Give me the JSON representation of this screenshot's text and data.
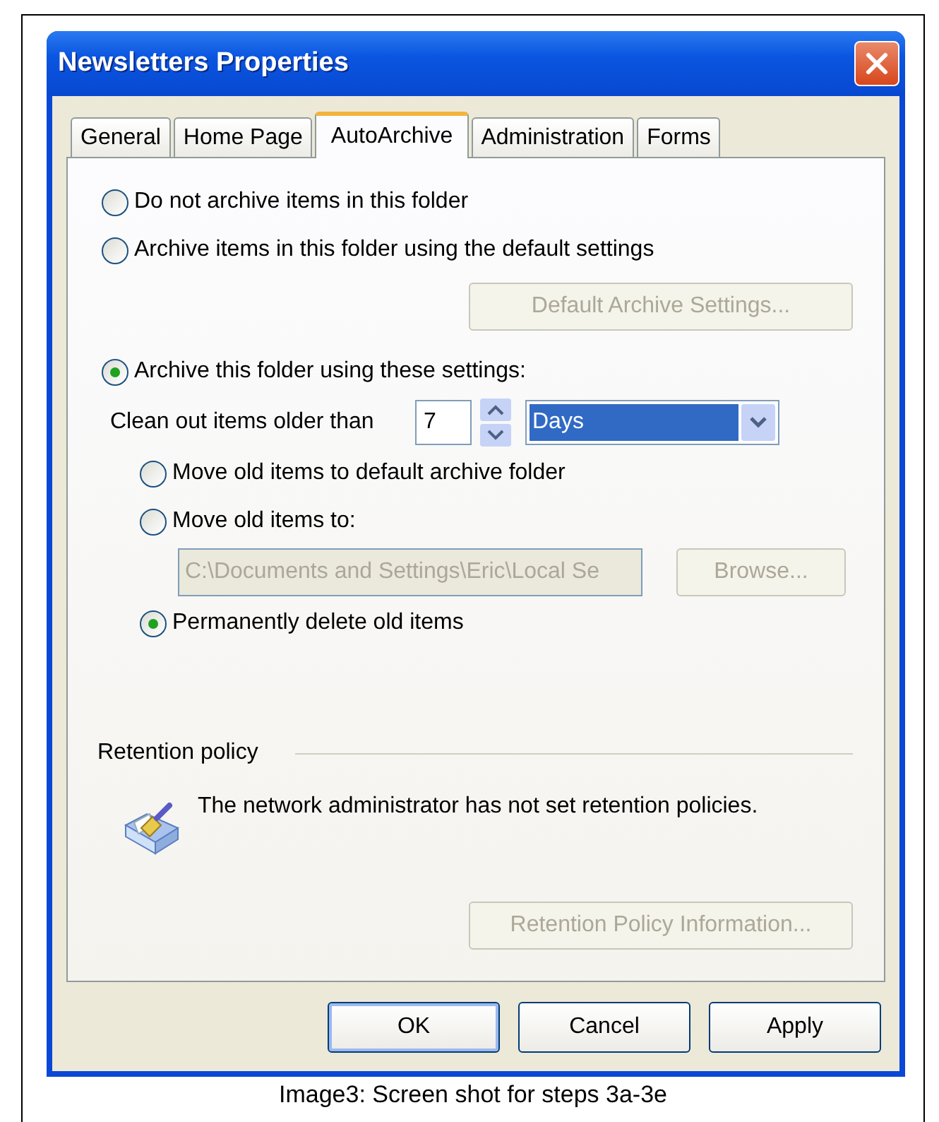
{
  "window": {
    "title": "Newsletters Properties"
  },
  "tabs": [
    {
      "label": "General",
      "selected": false
    },
    {
      "label": "Home Page",
      "selected": false
    },
    {
      "label": "AutoArchive",
      "selected": true
    },
    {
      "label": "Administration",
      "selected": false
    },
    {
      "label": "Forms",
      "selected": false
    }
  ],
  "archive_options": [
    {
      "label": "Do not archive items in this folder",
      "selected": false
    },
    {
      "label": "Archive items in this folder using the default settings",
      "selected": false
    },
    {
      "label": "Archive this folder using these settings:",
      "selected": true
    }
  ],
  "default_settings_button": {
    "label": "Default Archive Settings...",
    "disabled": true
  },
  "clean_out": {
    "label": "Clean out items older than",
    "value": "7",
    "unit": "Days"
  },
  "old_item_options": [
    {
      "label": "Move old items to default archive folder",
      "selected": false
    },
    {
      "label": "Move old items to:",
      "selected": false
    },
    {
      "label": "Permanently delete old items",
      "selected": true
    }
  ],
  "path_field": {
    "value": "C:\\Documents and Settings\\Eric\\Local Se",
    "disabled": true
  },
  "browse_button": {
    "label": "Browse...",
    "disabled": true
  },
  "retention_policy": {
    "heading": "Retention policy",
    "message": "The network administrator has not set retention policies.",
    "button": {
      "label": "Retention Policy Information...",
      "disabled": true
    }
  },
  "buttons": [
    {
      "label": "OK",
      "default": true
    },
    {
      "label": "Cancel",
      "default": false
    },
    {
      "label": "Apply",
      "default": false
    }
  ],
  "caption": "Image3: Screen shot for steps 3a-3e"
}
